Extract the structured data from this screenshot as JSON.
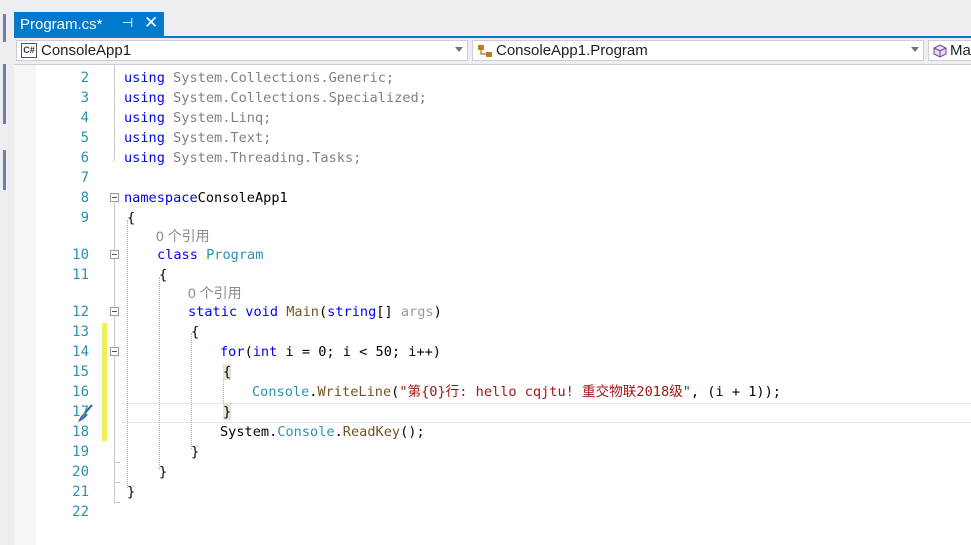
{
  "tab": {
    "title": "Program.cs*",
    "pin": "⊣",
    "close": "✕"
  },
  "navbar": {
    "project": "ConsoleApp1",
    "class": "ConsoleApp1.Program",
    "member": "Ma",
    "project_icon": "csharp-project-icon",
    "class_icon": "class-icon",
    "member_icon": "method-cube-icon"
  },
  "lines": [
    {
      "n": "2",
      "tokens": [
        [
          "k",
          "using"
        ],
        [
          "g",
          " System.Collections.Generic;"
        ]
      ]
    },
    {
      "n": "3",
      "tokens": [
        [
          "k",
          "using"
        ],
        [
          "g",
          " System.Collections.Specialized;"
        ]
      ]
    },
    {
      "n": "4",
      "tokens": [
        [
          "k",
          "using"
        ],
        [
          "g",
          " System.Linq;"
        ]
      ]
    },
    {
      "n": "5",
      "tokens": [
        [
          "k",
          "using"
        ],
        [
          "g",
          " System.Text;"
        ]
      ]
    },
    {
      "n": "6",
      "tokens": [
        [
          "k",
          "using"
        ],
        [
          "g",
          " System.Threading.Tasks;"
        ]
      ]
    },
    {
      "n": "7",
      "tokens": []
    },
    {
      "n": "8",
      "tokens": [
        [
          "k",
          "namespace"
        ],
        [
          "",
          "ConsoleApp1"
        ]
      ]
    },
    {
      "n": "9",
      "tokens": [
        [
          "",
          "{"
        ]
      ]
    },
    {
      "n": "10",
      "lens": "0 个引用",
      "tokens": [
        [
          "k",
          "class"
        ],
        [
          "",
          " "
        ],
        [
          "t",
          "Program"
        ]
      ]
    },
    {
      "n": "11",
      "tokens": [
        [
          "",
          "{"
        ]
      ]
    },
    {
      "n": "12",
      "lens": "0 个引用",
      "tokens": [
        [
          "k",
          "static void"
        ],
        [
          "",
          " "
        ],
        [
          "m",
          "Main"
        ],
        [
          "",
          "("
        ],
        [
          "k",
          "string"
        ],
        [
          "",
          "[] "
        ],
        [
          "p",
          "args"
        ],
        [
          "",
          ")"
        ]
      ]
    },
    {
      "n": "13",
      "tokens": [
        [
          "",
          "{"
        ]
      ]
    },
    {
      "n": "14",
      "tokens": [
        [
          "k",
          "for"
        ],
        [
          "",
          "("
        ],
        [
          "k",
          "int"
        ],
        [
          "",
          " i = 0; i < 50; i++)"
        ]
      ]
    },
    {
      "n": "15",
      "tokens": [
        [
          "hl",
          "{"
        ]
      ]
    },
    {
      "n": "16",
      "tokens": [
        [
          "t",
          "Console"
        ],
        [
          "",
          "."
        ],
        [
          "m",
          "WriteLine"
        ],
        [
          "",
          "("
        ],
        [
          "s",
          "\"第{0}行: hello cqjtu! 重交物联2018级\""
        ],
        [
          "",
          ", (i + 1));"
        ]
      ]
    },
    {
      "n": "17",
      "tokens": [
        [
          "hl",
          "}"
        ]
      ]
    },
    {
      "n": "18",
      "tokens": [
        [
          "",
          "System."
        ],
        [
          "t",
          "Console"
        ],
        [
          "",
          "."
        ],
        [
          "m",
          "ReadKey"
        ],
        [
          "",
          "();"
        ]
      ]
    },
    {
      "n": "19",
      "tokens": [
        [
          "",
          "}"
        ]
      ]
    },
    {
      "n": "20",
      "tokens": [
        [
          "",
          "}"
        ]
      ]
    },
    {
      "n": "21",
      "tokens": [
        [
          "",
          "}"
        ]
      ]
    },
    {
      "n": "22",
      "tokens": []
    }
  ]
}
